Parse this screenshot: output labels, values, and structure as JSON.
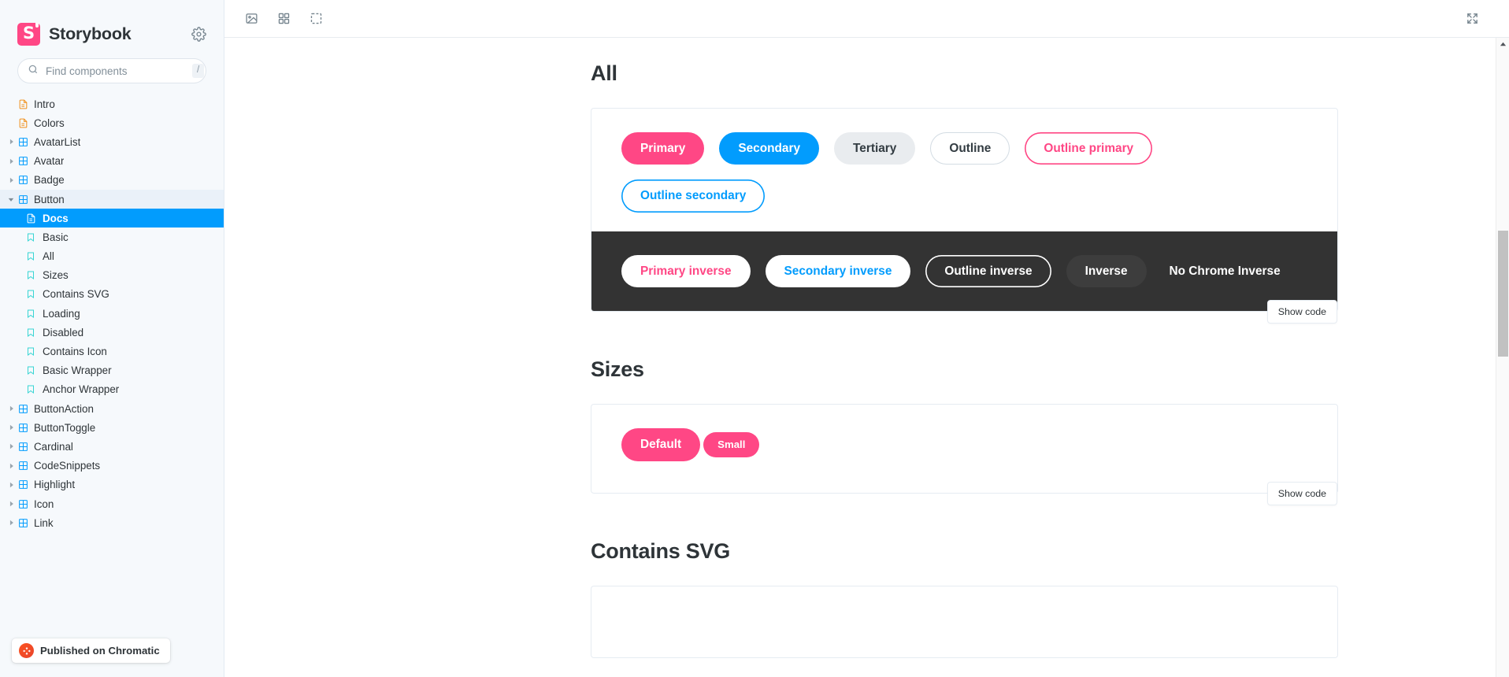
{
  "sidebar": {
    "brand": "Storybook",
    "logo_color": "#FF4785",
    "gear_icon": "gear-icon",
    "search": {
      "placeholder": "Find components",
      "value": "",
      "shortcut": "/",
      "icon": "search-icon"
    },
    "tree": [
      {
        "label": "Intro",
        "type": "doc",
        "depth": 0,
        "caret": "none",
        "state": "normal"
      },
      {
        "label": "Colors",
        "type": "doc",
        "depth": 0,
        "caret": "none",
        "state": "normal"
      },
      {
        "label": "AvatarList",
        "type": "component",
        "depth": 0,
        "caret": "collapsed",
        "state": "normal"
      },
      {
        "label": "Avatar",
        "type": "component",
        "depth": 0,
        "caret": "collapsed",
        "state": "normal"
      },
      {
        "label": "Badge",
        "type": "component",
        "depth": 0,
        "caret": "collapsed",
        "state": "normal"
      },
      {
        "label": "Button",
        "type": "component",
        "depth": 0,
        "caret": "expanded",
        "state": "expanded"
      },
      {
        "label": "Docs",
        "type": "docs",
        "depth": 1,
        "caret": "none",
        "state": "selected"
      },
      {
        "label": "Basic",
        "type": "story",
        "depth": 1,
        "caret": "none",
        "state": "normal"
      },
      {
        "label": "All",
        "type": "story",
        "depth": 1,
        "caret": "none",
        "state": "normal"
      },
      {
        "label": "Sizes",
        "type": "story",
        "depth": 1,
        "caret": "none",
        "state": "normal"
      },
      {
        "label": "Contains SVG",
        "type": "story",
        "depth": 1,
        "caret": "none",
        "state": "normal"
      },
      {
        "label": "Loading",
        "type": "story",
        "depth": 1,
        "caret": "none",
        "state": "normal"
      },
      {
        "label": "Disabled",
        "type": "story",
        "depth": 1,
        "caret": "none",
        "state": "normal"
      },
      {
        "label": "Contains Icon",
        "type": "story",
        "depth": 1,
        "caret": "none",
        "state": "normal"
      },
      {
        "label": "Basic Wrapper",
        "type": "story",
        "depth": 1,
        "caret": "none",
        "state": "normal"
      },
      {
        "label": "Anchor Wrapper",
        "type": "story",
        "depth": 1,
        "caret": "none",
        "state": "normal"
      },
      {
        "label": "ButtonAction",
        "type": "component",
        "depth": 0,
        "caret": "collapsed",
        "state": "normal"
      },
      {
        "label": "ButtonToggle",
        "type": "component",
        "depth": 0,
        "caret": "collapsed",
        "state": "normal"
      },
      {
        "label": "Cardinal",
        "type": "component",
        "depth": 0,
        "caret": "collapsed",
        "state": "normal"
      },
      {
        "label": "CodeSnippets",
        "type": "component",
        "depth": 0,
        "caret": "collapsed",
        "state": "normal"
      },
      {
        "label": "Highlight",
        "type": "component",
        "depth": 0,
        "caret": "collapsed",
        "state": "normal"
      },
      {
        "label": "Icon",
        "type": "component",
        "depth": 0,
        "caret": "collapsed",
        "state": "normal"
      },
      {
        "label": "Link",
        "type": "component",
        "depth": 0,
        "caret": "collapsed",
        "state": "normal"
      }
    ],
    "chromatic_badge": {
      "label": "Published on Chromatic",
      "icon": "chromatic-logo-icon"
    }
  },
  "toolbar": {
    "left_tools": [
      {
        "name": "zoom-image-icon",
        "title": "Change the background of the preview"
      },
      {
        "name": "grid-icon",
        "title": "Apply a grid to the preview"
      },
      {
        "name": "measure-icon",
        "title": "Enable measure"
      }
    ],
    "right_tools": [
      {
        "name": "expand-icon",
        "title": "Go full screen"
      }
    ]
  },
  "doc": {
    "sections": [
      {
        "heading": "All",
        "show_code": "Show code",
        "light_buttons": [
          {
            "label": "Primary",
            "variant": "b-primary"
          },
          {
            "label": "Secondary",
            "variant": "b-secondary"
          },
          {
            "label": "Tertiary",
            "variant": "b-tertiary"
          },
          {
            "label": "Outline",
            "variant": "b-outline"
          },
          {
            "label": "Outline primary",
            "variant": "b-outline-primary"
          },
          {
            "label": "Outline secondary",
            "variant": "b-outline-secondary"
          }
        ],
        "inverse_buttons": [
          {
            "label": "Primary inverse",
            "variant": "b-primary-inv"
          },
          {
            "label": "Secondary inverse",
            "variant": "b-secondary-inv"
          },
          {
            "label": "Outline inverse",
            "variant": "b-outline-inv"
          },
          {
            "label": "Inverse",
            "variant": "b-inverse"
          },
          {
            "label": "No Chrome Inverse",
            "variant": "b-nochrome-inv"
          }
        ]
      },
      {
        "heading": "Sizes",
        "show_code": "Show code",
        "size_buttons": [
          {
            "label": "Default",
            "variant": "b-primary",
            "size": ""
          },
          {
            "label": "Small",
            "variant": "b-primary",
            "size": "sm"
          }
        ]
      },
      {
        "heading": "Contains SVG"
      }
    ]
  },
  "colors": {
    "primary": "#FF4785",
    "secondary": "#029CFD",
    "tertiary": "#e9ecef",
    "inverse_band": "#333333",
    "selected_row": "#029CFD",
    "sidebar_bg": "#f6f9fc"
  }
}
